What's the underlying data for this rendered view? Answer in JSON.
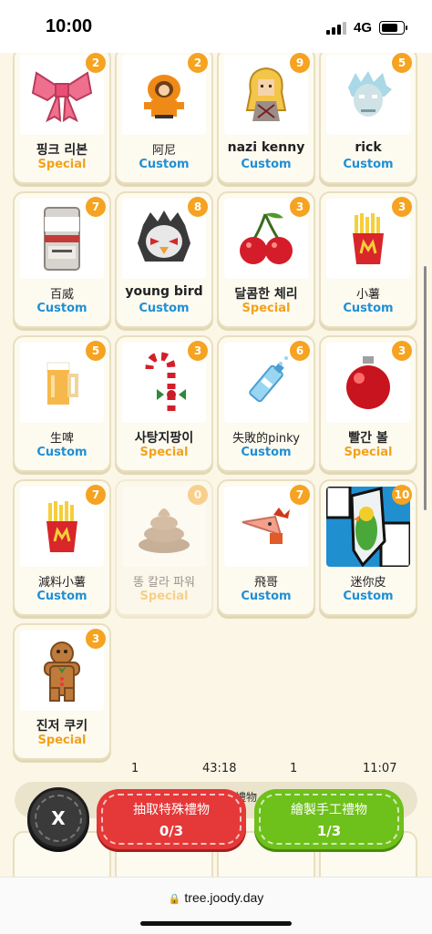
{
  "status": {
    "time": "10:00",
    "network": "4G"
  },
  "cards": [
    {
      "name": "핑크 리본",
      "type": "Special",
      "count": "2",
      "icon": "pink-ribbon-icon",
      "bold": true
    },
    {
      "name": "阿尼",
      "type": "Custom",
      "count": "2",
      "icon": "kenny-icon",
      "bold": false
    },
    {
      "name": "nazi kenny",
      "type": "Custom",
      "count": "9",
      "icon": "blonde-character-icon",
      "bold": true
    },
    {
      "name": "rick",
      "type": "Custom",
      "count": "5",
      "icon": "rick-face-icon",
      "bold": true
    },
    {
      "name": "百威",
      "type": "Custom",
      "count": "7",
      "icon": "beer-can-icon",
      "bold": false
    },
    {
      "name": "young bird",
      "type": "Custom",
      "count": "8",
      "icon": "angry-bird-icon",
      "bold": true
    },
    {
      "name": "달콤한 체리",
      "type": "Special",
      "count": "3",
      "icon": "cherry-icon",
      "bold": true
    },
    {
      "name": "小薯",
      "type": "Custom",
      "count": "3",
      "icon": "fries-icon",
      "bold": false
    },
    {
      "name": "生啤",
      "type": "Custom",
      "count": "5",
      "icon": "beer-mug-icon",
      "bold": false
    },
    {
      "name": "사탕지팡이",
      "type": "Special",
      "count": "3",
      "icon": "candy-cane-icon",
      "bold": true
    },
    {
      "name": "失敗的pinky",
      "type": "Custom",
      "count": "6",
      "icon": "blue-bottle-icon",
      "bold": false
    },
    {
      "name": "빨간 볼",
      "type": "Special",
      "count": "3",
      "icon": "red-ornament-icon",
      "bold": true
    },
    {
      "name": "減料小薯",
      "type": "Custom",
      "count": "7",
      "icon": "fries-icon",
      "bold": false
    },
    {
      "name": "똥 칼라 파워",
      "type": "Special",
      "count": "0",
      "icon": "poop-icon",
      "bold": false
    },
    {
      "name": "飛哥",
      "type": "Custom",
      "count": "7",
      "icon": "phineas-icon",
      "bold": false
    },
    {
      "name": "迷你皮",
      "type": "Custom",
      "count": "10",
      "icon": "parrot-icon",
      "bold": false
    },
    {
      "name": "진저 쿠키",
      "type": "Special",
      "count": "3",
      "icon": "gingerbread-icon",
      "bold": true
    }
  ],
  "timers": {
    "left_count": "1",
    "left_time": "43:18",
    "right_count": "1",
    "right_time": "11:07"
  },
  "strip_text": "禮物",
  "actions": {
    "close_label": "X",
    "special_label": "抽取特殊禮物",
    "special_count": "0/3",
    "custom_label": "繪製手工禮物",
    "custom_count": "1/3"
  },
  "browser": {
    "url": "tree.joody.day"
  },
  "colors": {
    "special": "#f2a21c",
    "custom": "#1f8fd6",
    "badge": "#f5a320",
    "special_button": "#e53838",
    "custom_button": "#6ec01a"
  }
}
